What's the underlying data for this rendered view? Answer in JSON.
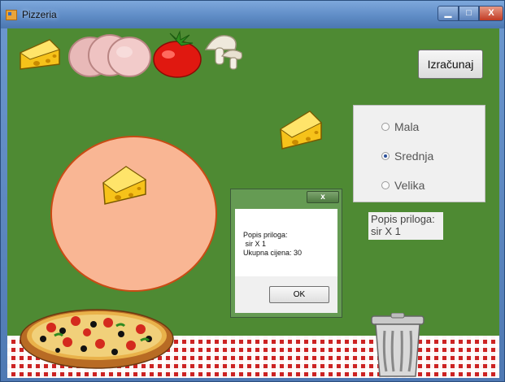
{
  "window": {
    "title": "Pizzeria",
    "minimize_glyph": "▁",
    "maximize_glyph": "□",
    "close_glyph": "X"
  },
  "toolbar": {
    "ingredients": [
      {
        "name": "cheese",
        "icon": "cheese-icon"
      },
      {
        "name": "ham",
        "icon": "ham-icon"
      },
      {
        "name": "tomato",
        "icon": "tomato-icon"
      },
      {
        "name": "mushroom",
        "icon": "mushroom-icon"
      }
    ]
  },
  "calculate_button": {
    "label": "Izračunaj"
  },
  "size_options": {
    "selected": "Srednja",
    "items": [
      {
        "label": "Mala",
        "checked": false
      },
      {
        "label": "Srednja",
        "checked": true
      },
      {
        "label": "Velika",
        "checked": false
      }
    ]
  },
  "summary": {
    "line1": "Popis priloga:",
    "line2": "sir X 1"
  },
  "dialog": {
    "close_glyph": "x",
    "message": "Popis priloga:\n sir X 1\nUkupna cijena: 30",
    "ok_label": "OK"
  },
  "colors": {
    "background": "#4e8a33",
    "pizza_base": "#f9b694",
    "cloth": "#cc2222"
  }
}
